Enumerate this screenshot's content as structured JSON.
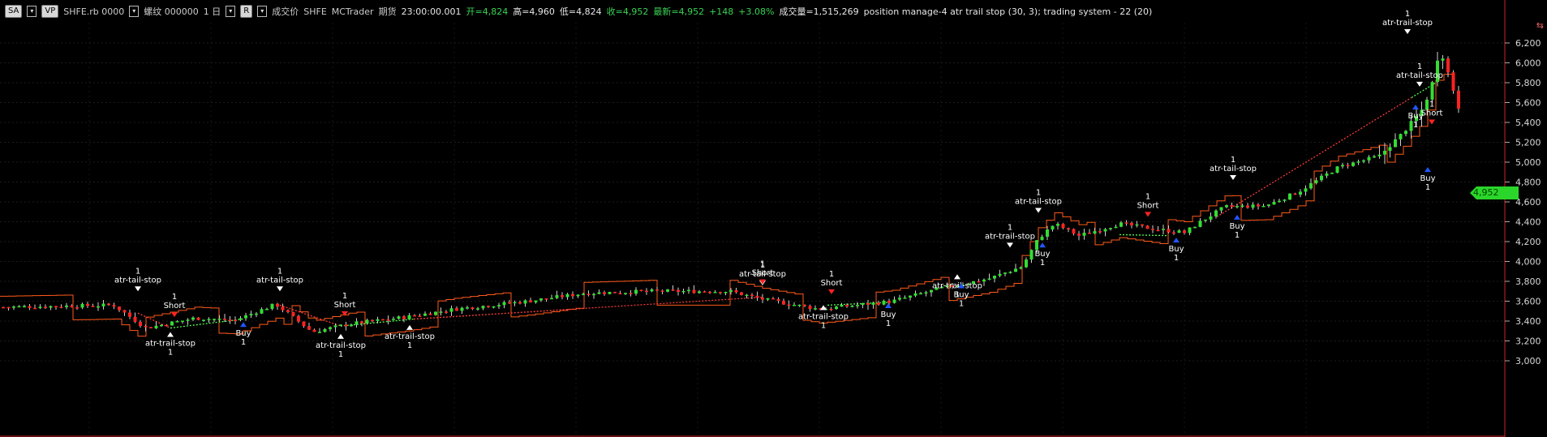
{
  "header": {
    "sa_btn": "SA",
    "vp_btn": "VP",
    "symbol": "SHFE.rb 0000",
    "contract": "螺纹 000000",
    "period": "1 日",
    "r_btn": "R",
    "price_type": "成交价",
    "exchange": "SHFE",
    "platform": "MCTrader",
    "futures": "期货",
    "time": "23:00:00.001",
    "open": "开=4,824",
    "high": "高=4,960",
    "low": "低=4,824",
    "close": "收=4,952",
    "last": "最新=4,952",
    "change": "+148",
    "change_pct": "+3.08%",
    "volume": "成交量=1,515,269",
    "strategy": "position manage-4 atr trail stop (30,  3); trading system - 22 (20)"
  },
  "price_tag": "4,952",
  "colors": {
    "up": "#33dd33",
    "down": "#ff2222",
    "stop_line": "#ff5a1a",
    "buy_arrow": "#2255ff",
    "accent": "#2bd62b"
  },
  "axis": {
    "labels": [
      "6,200",
      "6,000",
      "5,800",
      "5,600",
      "5,400",
      "5,200",
      "5,000",
      "4,800",
      "4,600",
      "4,400",
      "4,200",
      "4,000",
      "3,800",
      "3,600",
      "3,400",
      "3,200",
      "3,000"
    ]
  },
  "signals": [
    {
      "label": "atr-tail-stop",
      "qty": "1"
    },
    {
      "label": "Short",
      "qty": "1"
    },
    {
      "label": "atr-trail-stop",
      "qty": "1"
    },
    {
      "label": "Buy",
      "qty": "1"
    },
    {
      "label": "atr-tail-stop",
      "qty": "1"
    },
    {
      "label": "Short",
      "qty": "1"
    },
    {
      "label": "atr-trail-stop",
      "qty": "1"
    },
    {
      "label": "atr-trail-stop",
      "qty": "1"
    },
    {
      "label": "atr-tail-stop",
      "qty": "1"
    },
    {
      "label": "Short",
      "qty": "1"
    },
    {
      "label": "Short",
      "qty": "1"
    },
    {
      "label": "atr-trail-stop",
      "qty": "1"
    },
    {
      "label": "Buy",
      "qty": "1"
    },
    {
      "label": "atr-trail-stop",
      "qty": "1"
    },
    {
      "label": "Buy",
      "qty": "1"
    },
    {
      "label": "atr-trail-stop",
      "qty": "1"
    },
    {
      "label": "atr-tail-stop",
      "qty": "1"
    },
    {
      "label": "Buy",
      "qty": "1"
    },
    {
      "label": "Short",
      "qty": "1"
    },
    {
      "label": "Buy",
      "qty": "1"
    },
    {
      "label": "atr-tail-stop",
      "qty": "1"
    },
    {
      "label": "Buy",
      "qty": "1"
    },
    {
      "label": "atr-trail-stop",
      "qty": "1"
    },
    {
      "label": "atr-tail-stop",
      "qty": "1"
    },
    {
      "label": "Buy",
      "qty": "1"
    },
    {
      "label": "Short",
      "qty": "1"
    },
    {
      "label": "Buy",
      "qty": "1"
    }
  ]
}
